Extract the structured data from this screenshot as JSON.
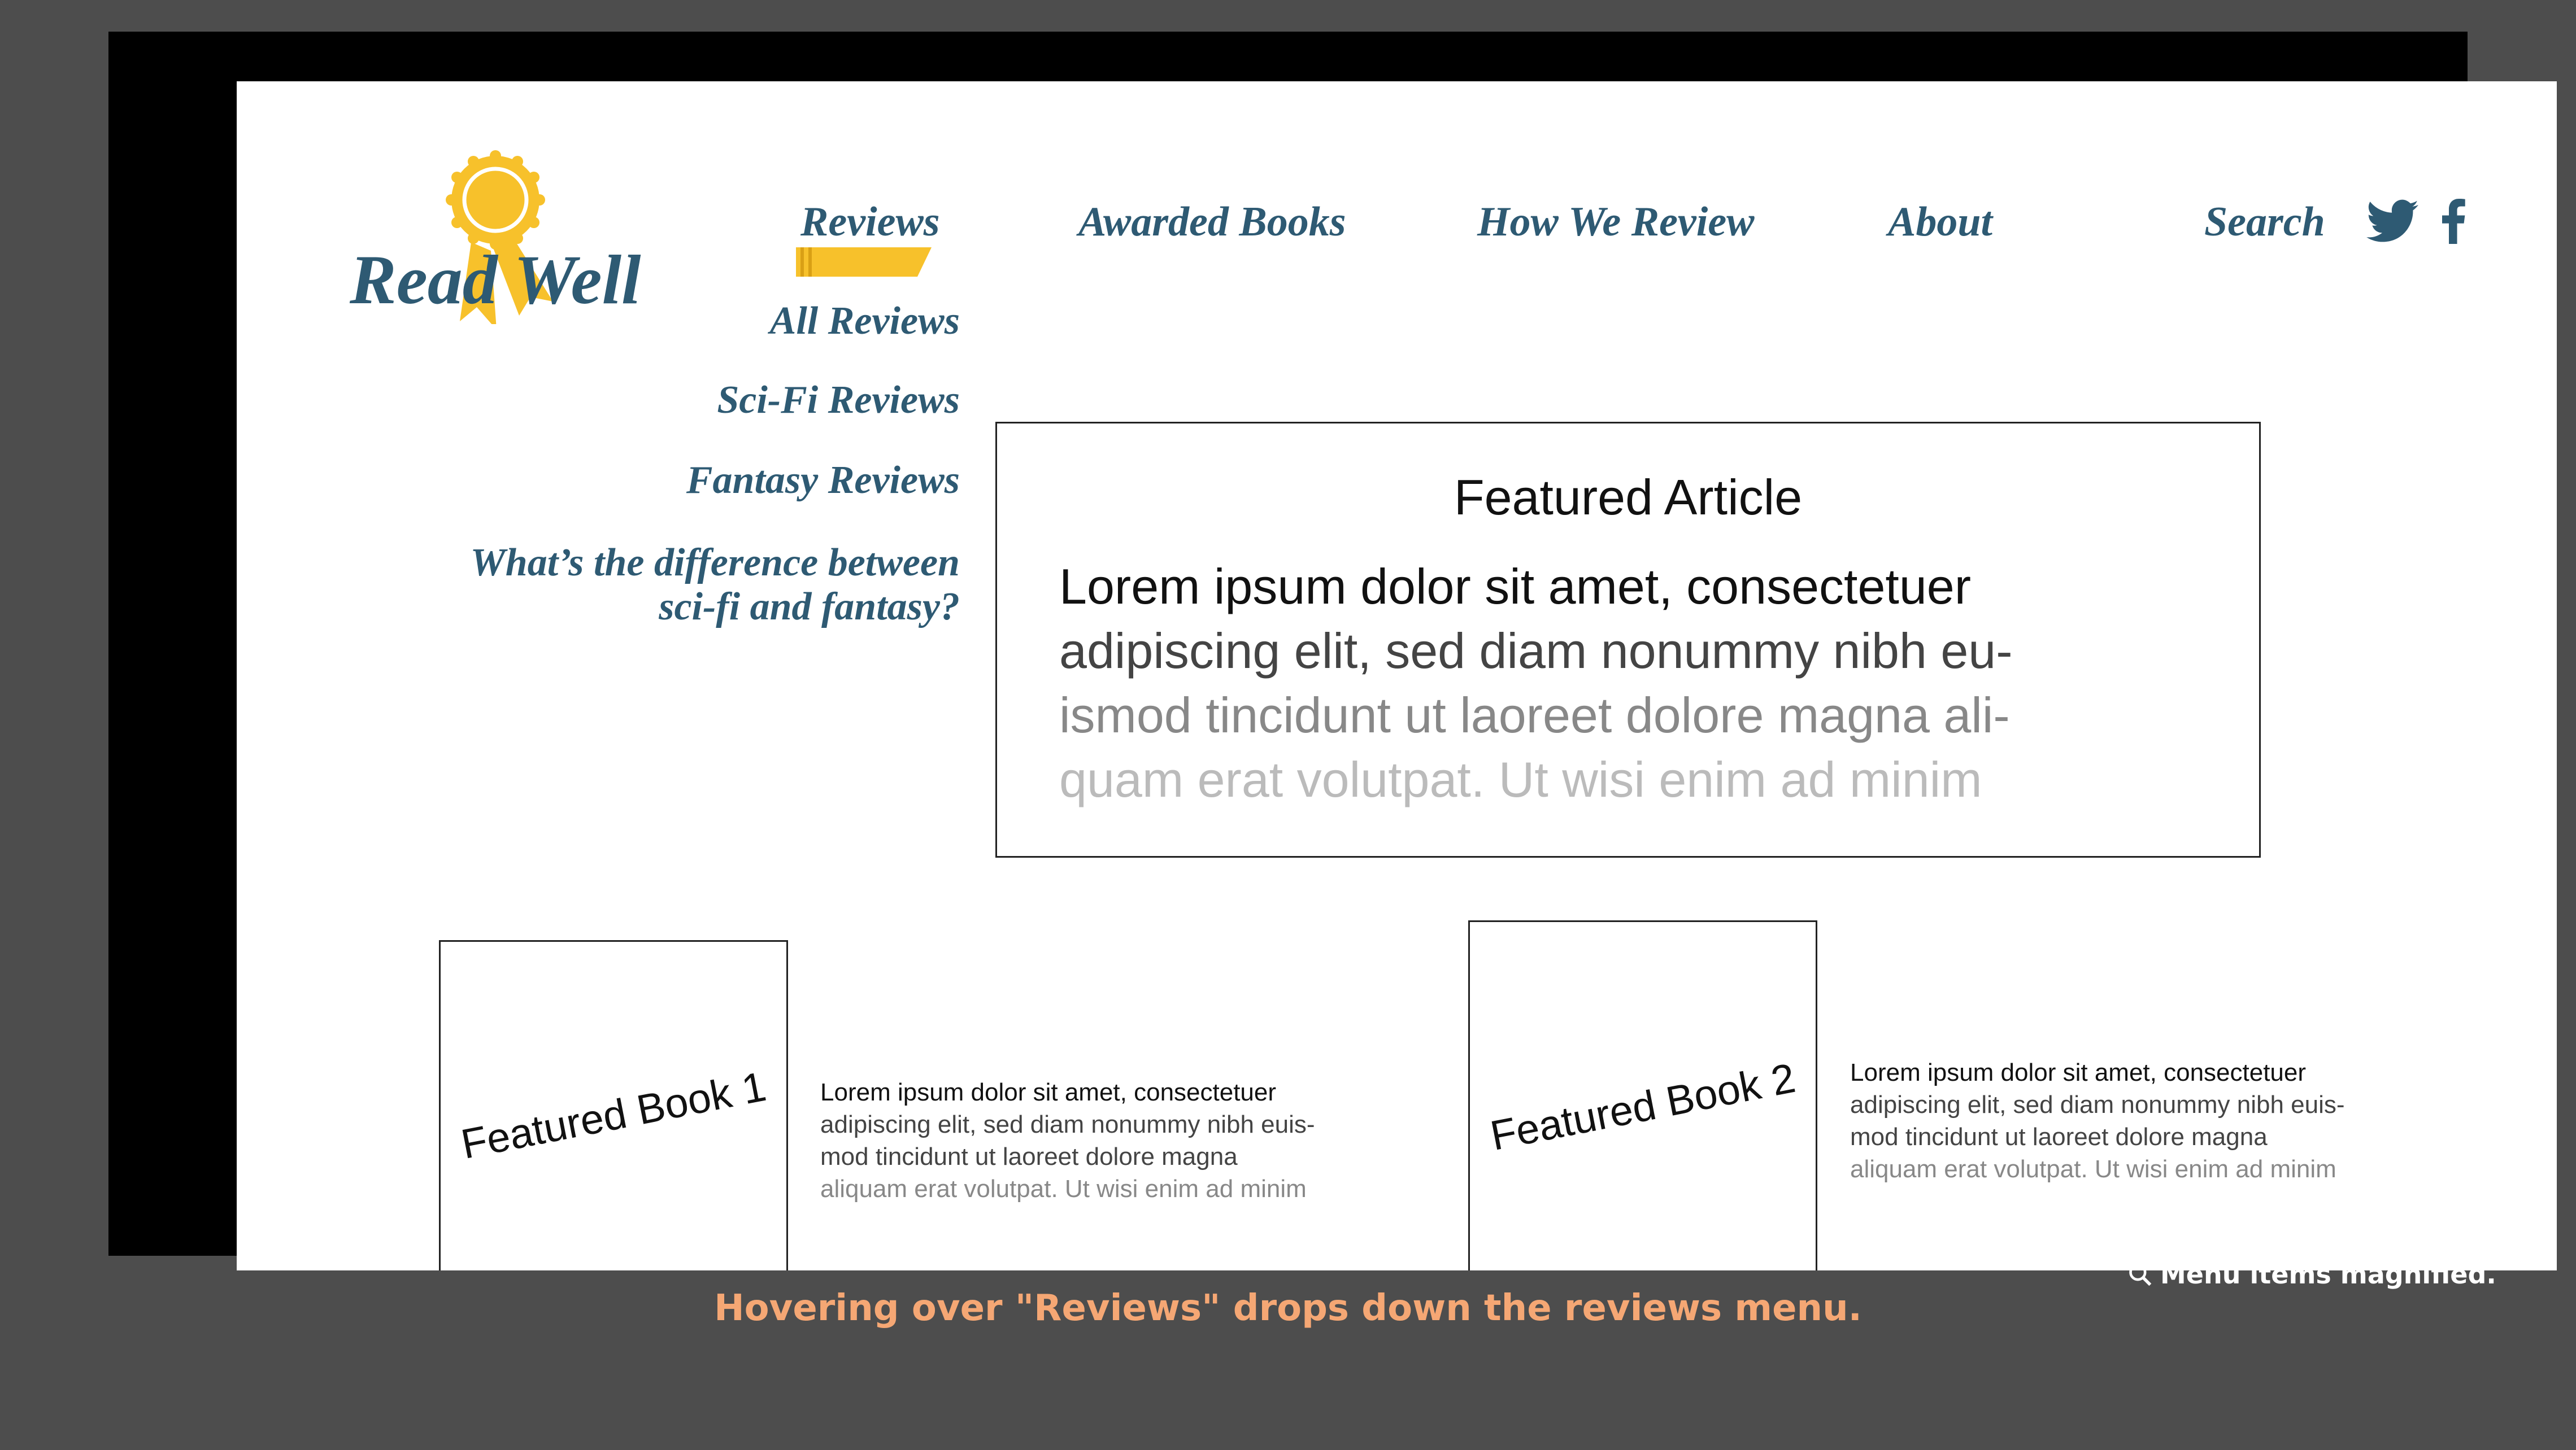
{
  "brand": {
    "name": "Read Well",
    "accent": "#f7c12b",
    "text_color": "#2e5a73"
  },
  "nav": {
    "reviews": "Reviews",
    "awarded": "Awarded Books",
    "how": "How We Review",
    "about": "About",
    "search": "Search",
    "icons": [
      "twitter-icon",
      "facebook-icon"
    ]
  },
  "dropdown": {
    "items": [
      {
        "label": "All Reviews"
      },
      {
        "label": "Sci-Fi Reviews"
      },
      {
        "label": "Fantasy Reviews"
      },
      {
        "label_line1": "What’s the difference between",
        "label_line2": "sci-fi and fantasy?"
      }
    ]
  },
  "featured_article": {
    "title": "Featured Article",
    "lines": [
      "Lorem ipsum dolor sit amet, consectetuer",
      "adipiscing elit, sed diam nonummy nibh eu-",
      "ismod tincidunt ut laoreet dolore magna ali-",
      "quam erat volutpat. Ut wisi enim ad minim"
    ]
  },
  "books": [
    {
      "label": "Featured Book 1",
      "desc": [
        "Lorem ipsum dolor sit amet, consectetuer",
        "adipiscing elit, sed diam nonummy nibh euis-",
        "mod tincidunt ut laoreet dolore magna",
        "aliquam erat volutpat. Ut wisi enim ad minim"
      ]
    },
    {
      "label": "Featured Book 2",
      "desc": [
        "Lorem ipsum dolor sit amet, consectetuer",
        "adipiscing elit, sed diam nonummy nibh euis-",
        "mod tincidunt ut laoreet dolore magna",
        "aliquam erat volutpat. Ut wisi enim ad minim"
      ]
    }
  ],
  "annotations": {
    "magnify_note": "Menu items magnified.",
    "caption": "Hovering over \"Reviews\" drops down the reviews menu."
  }
}
